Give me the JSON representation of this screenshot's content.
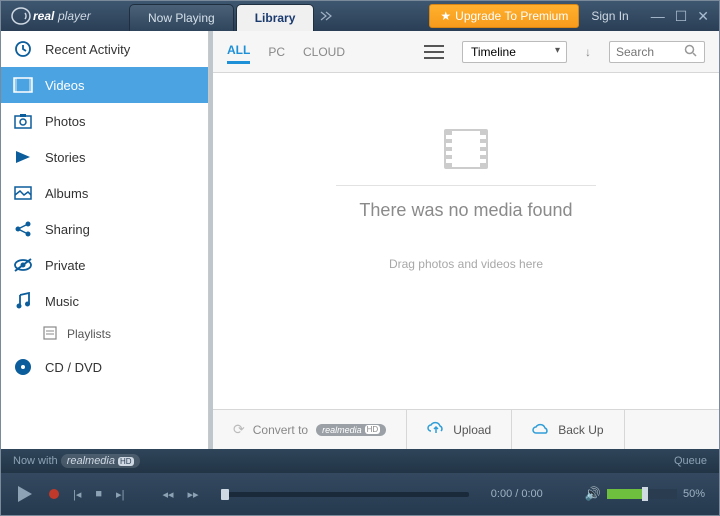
{
  "titlebar": {
    "logo_brand": "real",
    "logo_product": "player",
    "tabs": [
      {
        "label": "Now Playing",
        "active": false
      },
      {
        "label": "Library",
        "active": true
      }
    ],
    "upgrade_label": "Upgrade To Premium",
    "signin_label": "Sign In"
  },
  "sidebar": {
    "items": [
      {
        "label": "Recent Activity",
        "icon": "clock-icon"
      },
      {
        "label": "Videos",
        "icon": "video-icon",
        "selected": true
      },
      {
        "label": "Photos",
        "icon": "photo-icon"
      },
      {
        "label": "Stories",
        "icon": "stories-icon"
      },
      {
        "label": "Albums",
        "icon": "album-icon"
      },
      {
        "label": "Sharing",
        "icon": "share-icon"
      },
      {
        "label": "Private",
        "icon": "private-icon"
      },
      {
        "label": "Music",
        "icon": "music-icon",
        "children": [
          {
            "label": "Playlists",
            "icon": "playlist-icon"
          }
        ]
      },
      {
        "label": "CD / DVD",
        "icon": "disc-icon"
      }
    ]
  },
  "toolbar": {
    "filters": [
      {
        "label": "ALL",
        "active": true
      },
      {
        "label": "PC",
        "active": false
      },
      {
        "label": "CLOUD",
        "active": false
      }
    ],
    "sort_dropdown": "Timeline",
    "search_placeholder": "Search"
  },
  "content": {
    "headline": "There was no media found",
    "subline": "Drag photos and videos here"
  },
  "actionbar": {
    "convert_prefix": "Convert to",
    "convert_brand": "realmedia",
    "convert_badge": "HD",
    "upload_label": "Upload",
    "backup_label": "Back Up"
  },
  "footer": {
    "now_with": "Now with",
    "brand": "realmedia",
    "badge": "HD",
    "queue_label": "Queue",
    "time_display": "0:00 / 0:00",
    "volume_pct": "50%"
  }
}
